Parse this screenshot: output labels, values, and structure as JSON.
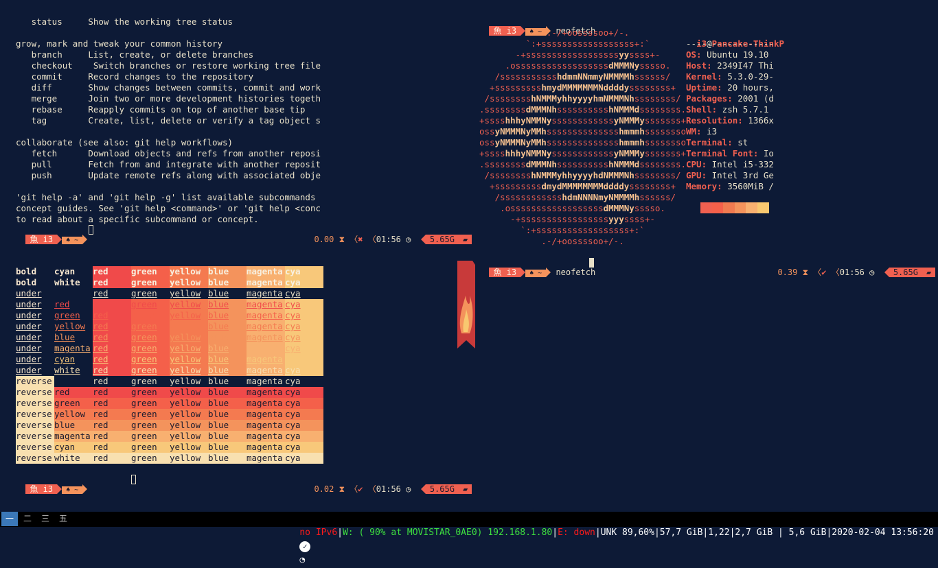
{
  "git_help": {
    "lines": [
      "   status     Show the working tree status",
      "",
      "grow, mark and tweak your common history",
      "   branch     List, create, or delete branches",
      "   checkout    Switch branches or restore working tree file",
      "   commit     Record changes to the repository",
      "   diff       Show changes between commits, commit and work",
      "   merge      Join two or more development histories togeth",
      "   rebase     Reapply commits on top of another base tip",
      "   tag        Create, list, delete or verify a tag object s",
      "",
      "collaborate (see also: git help workflows)",
      "   fetch      Download objects and refs from another reposi",
      "   pull       Fetch from and integrate with another reposit",
      "   push       Update remote refs along with associated obje",
      "",
      "'git help -a' and 'git help -g' list available subcommands",
      "concept guides. See 'git help <command>' or 'git help <conc",
      "to read about a specific subcommand or concept."
    ]
  },
  "prompts": {
    "fish_label": "魚 i3",
    "home_label": "♠ ~",
    "top_left": {
      "load": "0.00",
      "mark": "✖",
      "time": "01:56",
      "mem": "5.65G"
    },
    "bottom_left": {
      "load": "0.02",
      "mark": "✔",
      "time": "01:56",
      "mem": "5.65G"
    },
    "right": {
      "load": "0.39",
      "mark": "✔",
      "time": "01:56",
      "mem": "5.65G",
      "command": "neofetch"
    },
    "right_top_command": "neofetch"
  },
  "neofetch": {
    "user": "i3",
    "at": "@",
    "host": "Pancake-ThinkP",
    "rule": "-----------------",
    "info": [
      {
        "key": "OS",
        "value": "Ubuntu 19.10"
      },
      {
        "key": "Host",
        "value": "2349I47 Thi"
      },
      {
        "key": "Kernel",
        "value": "5.3.0-29-"
      },
      {
        "key": "Uptime",
        "value": "20 hours,"
      },
      {
        "key": "Packages",
        "value": "2001 (d"
      },
      {
        "key": "Shell",
        "value": "zsh 5.7.1"
      },
      {
        "key": "Resolution",
        "value": "1366x"
      },
      {
        "key": "WM",
        "value": "i3"
      },
      {
        "key": "Terminal",
        "value": "st"
      },
      {
        "key": "Terminal Font",
        "value": "Io"
      },
      {
        "key": "CPU",
        "value": "Intel i5-332"
      },
      {
        "key": "GPU",
        "value": "Intel 3rd Ge"
      },
      {
        "key": "Memory",
        "value": "3560MiB /"
      }
    ],
    "swatches": [
      "#f06050",
      "#f4604a",
      "#f07a50",
      "#f4935c",
      "#f8b070",
      "#f8c870"
    ],
    "logo": [
      "             .-/+oossssoo+/-.",
      "         `:+ssssssssssssssssss+:`",
      "       -+ssssssssssssssssssyyssss+-",
      "     .ossssssssssssssssssdMMMNysssso.",
      "   /ssssssssssshdmmNNmmyNMMMMhssssss/",
      "  +ssssssssshmydMMMMMMMNddddyssssssss+",
      " /sssssssshNMMMyhhyyyyhmNMMMNhssssssss/",
      ".ssssssssdMMMNhsssssssssshNMMMdssssssss.",
      "+sssshhhyNMMNyssssssssssssyNMMMysssssss+",
      "ossyNMMMNyMMhsssssssssssssshmmmhssssssso",
      "ossyNMMMNyMMhsssssssssssssshmmmhssssssso",
      "+sssshhhyNMMNyssssssssssssyNMMMysssssss+",
      ".ssssssssdMMMNhsssssssssshNMMMdssssssss.",
      " /sssssssshNMMMyhhyyyyhdNMMMNhssssssss/",
      "  +sssssssssdmydMMMMMMMMddddyssssssss+",
      "   /sssssssssssshdmNNNNmyNMMMMhssssss/",
      "    .ossssssssssssssssssdMMMNysssso.",
      "      -+sssssssssssssssssyyyssss+-",
      "        `:+ssssssssssssssssss+:`",
      "            .-/+oossssoo+/-."
    ]
  },
  "colortest": {
    "rows": [
      {
        "a": "bold",
        "b": "cyan"
      },
      {
        "a": "bold",
        "b": "white"
      },
      {
        "a": "under",
        "b": ""
      },
      {
        "a": "under",
        "b": "red"
      },
      {
        "a": "under",
        "b": "green"
      },
      {
        "a": "under",
        "b": "yellow"
      },
      {
        "a": "under",
        "b": "blue"
      },
      {
        "a": "under",
        "b": "magenta"
      },
      {
        "a": "under",
        "b": "cyan"
      },
      {
        "a": "under",
        "b": "white"
      },
      {
        "a": "reverse",
        "b": ""
      },
      {
        "a": "reverse",
        "b": "red"
      },
      {
        "a": "reverse",
        "b": "green"
      },
      {
        "a": "reverse",
        "b": "yellow"
      },
      {
        "a": "reverse",
        "b": "blue"
      },
      {
        "a": "reverse",
        "b": "magenta"
      },
      {
        "a": "reverse",
        "b": "cyan"
      },
      {
        "a": "reverse",
        "b": "white"
      }
    ],
    "cols": [
      "red",
      "green",
      "yellow",
      "blue",
      "magenta",
      "cya"
    ],
    "col_colors": [
      "#f04a4a",
      "#f4604a",
      "#f47a50",
      "#f4935c",
      "#f8b070",
      "#f8c87a"
    ]
  },
  "bar": {
    "workspaces": [
      "一",
      "二",
      "三",
      "五"
    ],
    "active_ws": 0,
    "status": {
      "ipv6": "no IPv6",
      "wifi": "W: ( 90% at MOVISTAR_0AE0) 192.168.1.80",
      "eth": "E: down",
      "battery": "UNK 89,60%",
      "disk": "57,7 GiB",
      "load": "1,22",
      "mem": "2,7 GiB | 5,6 GiB",
      "datetime": "2020-02-04 13:56:20"
    },
    "colors": {
      "ok": "#3ee03e",
      "bad": "#ff1a1a",
      "text": "#ffffff"
    }
  }
}
